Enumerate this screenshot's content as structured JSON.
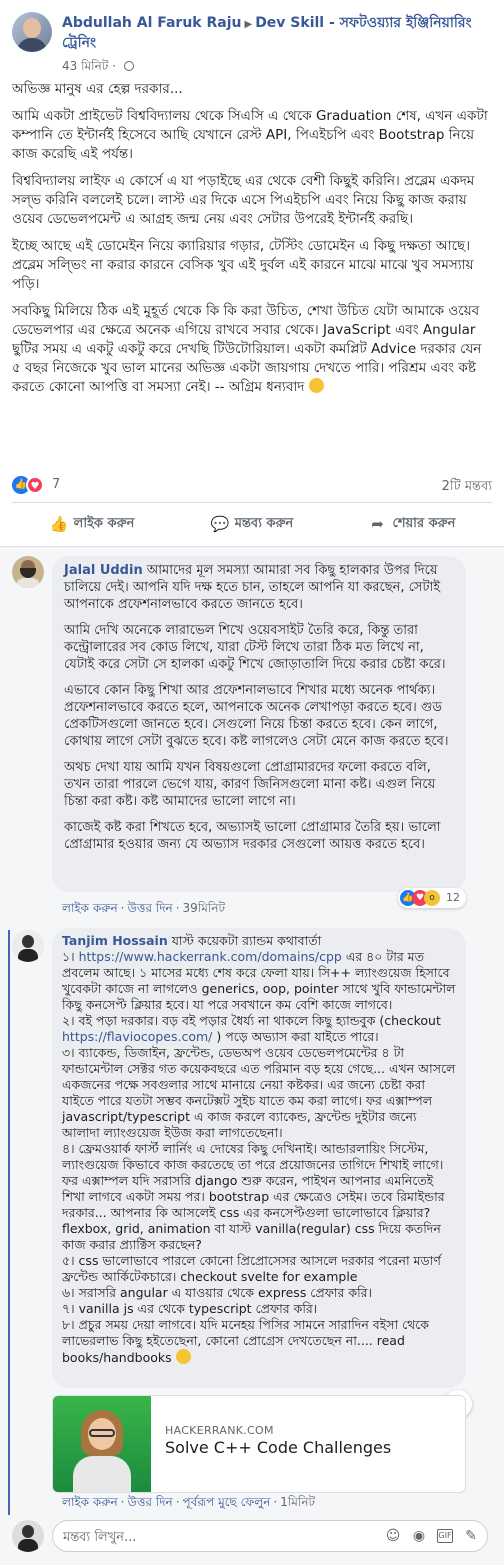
{
  "post": {
    "author": "Abdullah Al Faruk Raju",
    "group": "Dev Skill - সফটওয়্যার ইঞ্জিনিয়ারিং ট্রেনিং",
    "time": "43 মিনিট",
    "paragraphs": [
      "অভিজ্ঞ মানুষ এর হেল্প দরকার...",
      "আমি একটা প্রাইভেট বিশ্ববিদ্যালয় থেকে সিএসি এ থেকে Graduation শেষ, এখন একটা কম্পানি তে ইন্টার্নই হিসেবে আছি যেখানে রেস্ট API, পিএইচপি এবং Bootstrap নিয়ে কাজ করেছি এই পর্যন্ত।",
      "বিশ্ববিদ্যালয় লাইফ এ কোর্সে এ যা পড়াইছে এর থেকে বেশী কিছুই করিনি। প্রব্লেম একদম সল্ভ করিনি বললেই চলে। লাস্ট এর দিকে এসে পিএইচপি এবং নিয়ে কিছু কাজ করায় ওয়েব ডেভেলপমেন্ট এ আগ্রহ জন্ম নেয় এবং সেটার উপরেই ইন্টার্নই করছি।",
      "ইচ্ছে আছে এই ডোমেইন নিয়ে ক্যারিয়ার গড়ার, টেস্টিং ডোমেইন এ কিছু দক্ষতা আছে। প্রব্লেম সল্ভিং না করার কারনে বেসিক খুব এই দুর্বল এই কারনে মাঝে মাঝে খুব সমস্যায় পড়ি।",
      "সবকিছু মিলিয়ে ঠিক এই মুহূর্ত থেকে কি কি করা উচিত, শেখা উচিত যেটা আমাকে ওয়েব ডেভেলপার এর ক্ষেত্রে অনেক এগিয়ে রাখবে সবার থেকে। JavaScript এবং Angular ছুটির সময় এ একটু একটু করে দেখছি টিউটোরিয়াল। একটা কমপ্লিট Advice দরকার যেন ৫ বছর নিজেকে খুব ভাল মানের অভিজ্ঞ একটা জায়গায় দেখতে পারি। পরিশ্রম এবং কষ্ট করতে কোনো আপত্তি বা সমস্যা নেই। -- অগ্রিম ধন্যবাদ"
    ],
    "reaction_count": "7",
    "comment_count": "2টি মন্তব্য",
    "actions": {
      "like": "লাইক করুন",
      "comment": "মন্তব্য করুন",
      "share": "শেয়ার করুন"
    }
  },
  "comments": [
    {
      "name": "Jalal Uddin",
      "paragraphs": [
        "আমাদের মূল সমস্যা আমারা সব কিছু হালকার উপর দিয়ে চালিয়ে দেই। আপনি যদি দক্ষ হতে চান, তাহলে আপনি যা করছেন, সেটাই আপনাকে প্রফেশনালভাবে করতে জানতে হবে।",
        "আমি দেখি অনেকে লারাভেল শিখে ওয়েবসাইট তৈরি করে, কিন্তু তারা কন্ট্রোলারের সব কোড লিখে, যারা টেস্ট লিখে তারা ঠিক মত লিখে না, যেটাই করে সেটা সে হালকা একটু শিখে জোড়াতালি দিয়ে করার চেষ্টা করে।",
        "এভাবে কোন কিছু শিখা আর প্রফেশনালভাবে শিখার মধ্যে অনেক পার্থক্য। প্রফেশনালভাবে করতে হলে, আপনাকে অনেক লেখাপড়া করতে হবে। গুড প্রেকটিসগুলো জানতে হবে। সেগুলো নিয়ে চিন্তা করতে হবে। কেন লাগে, কোথায় লাগে সেটা বুঝতে হবে। কষ্ট লাগলেও সেটা মেনে কাজ করতে হবে।",
        "অথচ দেখা যায় আমি যখন বিষয়গুলো প্রোগ্রামারদের ফলো করতে বলি, তখন তারা পারলে ভেগে যায়, কারণ জিনিসগুলো মানা কষ্ট। এগুল নিয়ে চিন্তা করা কষ্ট। কষ্ট আমাদের ভালো লাগে না।",
        "কাজেই কষ্ট করা শিখতে হবে, অভ্যাসই ভালো প্রোগ্রামার তৈরি হয়। ভালো প্রোগ্রামার হওয়ার জন্য যে অভ্যাস দরকার সেগুলো আয়ত্ত করতে হবে।"
      ],
      "like": "লাইক করুন",
      "reply": "উত্তর দিন",
      "time": "39মিনিট",
      "reaction_count": "12"
    },
    {
      "name": "Tanjim Hossain",
      "lines": [
        {
          "pre": "যাস্ট কয়েকটা র‍্যান্ডম কথাবার্তা"
        },
        {
          "pre": "১। ",
          "link": "https://www.hackerrank.com/domains/cpp",
          "post": " এর ৪০ টার মত প্রবলেম আছে। ১ মাসের মধ্যে শেষ করে ফেলা যায়। সি++ ল্যাংগুয়েজ হিসাবে খুবেকটা কাজে না লাগলেও generics, oop, pointer সাথে খুবি ফান্ডামেন্টাল কিছু কনসেপ্ট ক্লিয়ার হবে। যা পরে সবখানে কম বেশি কাজে লাগবে।"
        },
        {
          "pre": "২। বই পড়া দরকার। বড় বই পড়ার ধৈর্য্য না থাকলে কিছু হ্যান্ডবুক (checkout ",
          "link": "https://flaviocopes.com/",
          "post": " ) পড়ে অভ্যাস করা যাইতে পারে।"
        },
        {
          "pre": "৩। ব্যাকেন্ড, ডিজাইন, ফ্রন্টেন্ড, ডেভঅপ ওয়েব ডেভেলপমেন্টের ৪ টা ফান্ডামেন্টাল সেক্টর গত কয়েকবছরে এত পরিমান বড় হয়ে গেছে... এখন আসলে একজনের পক্ষে সবগুলার সাথে মানায়ে নেয়া কষ্টকর। এর জন্যে চেষ্টা করা যাইতে পারে যতটা সম্ভব কনটেক্সট সুইচ যাতে কম করা লাগে। ফর এক্সাম্পল javascript/typescript এ কাজ করলে ব্যাকেন্ড, ফ্রন্টেন্ড দুইটার জন্যে আলাদা ল্যাংগুয়েজ ইউজ করা লাগতেছেনা।"
        },
        {
          "pre": "৪। ফ্রেমওয়ার্ক ফার্স্ট লার্নিং এ দোষের কিছু দেখিনাই। আন্ডারলায়িং সিস্টেম, ল্যাংগুয়েজ কিভাবে কাজ করতেছে তা পরে প্রয়োজনের তাগিদে শিখাই লাগে। ফর এক্সাম্পল যদি সরাসরি django শুরু করেন, পাইথন আপনার এমনিতেই শিখা লাগবে একটা সময় পর। bootstrap এর ক্ষেত্রেও সেইম। তবে রিমাইন্ডার দরকার... আপনার কি আসলেই css এর কনসেপ্টগুলা ভালোভাবে ক্লিয়ার? flexbox, grid, animation বা যাস্ট vanilla(regular) css দিয়ে কতদিন কাজ করার প্র্যাক্টিস করছেন?"
        },
        {
          "pre": "৫। css ভালোভাবে পারলে কোনো প্রিপ্রোসেসর আসলে দরকার পরেনা মডার্ণ ফ্রন্টেন্ড আর্কিটেকচারে। checkout svelte for example"
        },
        {
          "pre": "৬। সরাসরি angular এ যাওয়ার থেকে express প্রেফার করি।"
        },
        {
          "pre": "৭। vanilla js এর থেকে typescript প্রেফার করি।"
        },
        {
          "pre": "৮। প্রচুর সময় দেয়া লাগবে। যদি মনেহয় পিসির সামনে সারাদিন বইসা থেকে লাভেরলাভ কিছু হইতেছেনা, কোনো প্রোগ্রেস দেখতেছেন না.... read books/handbooks"
        }
      ],
      "link_card": {
        "domain": "HACKERRANK.COM",
        "title": "Solve C++ Code Challenges"
      },
      "like": "লাইক করুন",
      "reply": "উত্তর দিন",
      "preview": "পূর্বরূপ মুছে ফেলুন",
      "time": "1মিনিট"
    }
  ],
  "composer": {
    "placeholder": "মন্তব্য লিখুন..."
  },
  "colors": {
    "link": "#385898",
    "accent": "#1877f2",
    "love": "#f33e58",
    "reply_line": "#4267b2"
  }
}
